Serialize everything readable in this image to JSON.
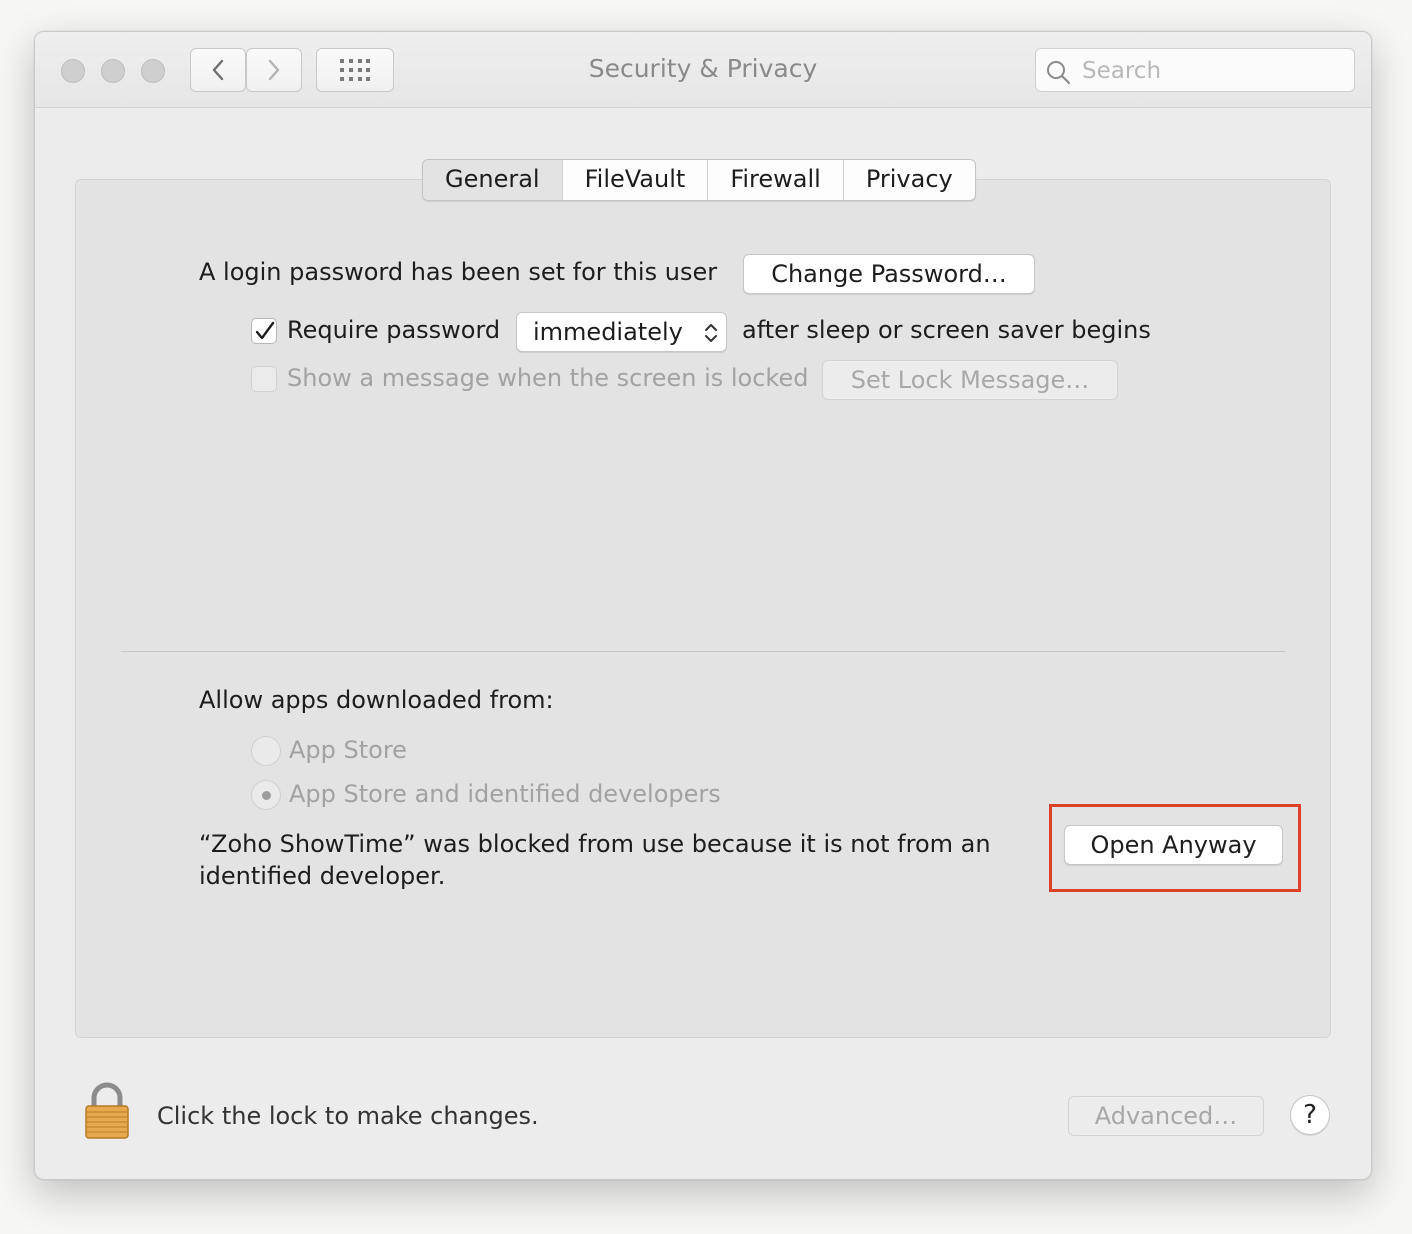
{
  "window": {
    "title": "Security & Privacy",
    "search": {
      "placeholder": "Search",
      "value": ""
    }
  },
  "tabs": [
    {
      "label": "General",
      "active": true
    },
    {
      "label": "FileVault",
      "active": false
    },
    {
      "label": "Firewall",
      "active": false
    },
    {
      "label": "Privacy",
      "active": false
    }
  ],
  "general": {
    "login_password_text": "A login password has been set for this user",
    "change_password_label": "Change Password…",
    "require_password": {
      "checked": true,
      "label": "Require password",
      "selected_option": "immediately",
      "suffix": "after sleep or screen saver begins"
    },
    "lock_message": {
      "checked": false,
      "label": "Show a message when the screen is locked",
      "button_label": "Set Lock Message…"
    }
  },
  "downloads": {
    "heading": "Allow apps downloaded from:",
    "options": [
      {
        "label": "App Store",
        "selected": false
      },
      {
        "label": "App Store and identified developers",
        "selected": true
      }
    ],
    "blocked_message_line1": "“Zoho ShowTime” was blocked from use because it is not from an",
    "blocked_message_line2": "identified developer.",
    "open_anyway_label": "Open Anyway"
  },
  "footer": {
    "lock_text": "Click the lock to make changes.",
    "advanced_label": "Advanced…",
    "help_label": "?"
  },
  "colors": {
    "highlight": "#e0412a",
    "lock_gold": "#e8a94e"
  }
}
